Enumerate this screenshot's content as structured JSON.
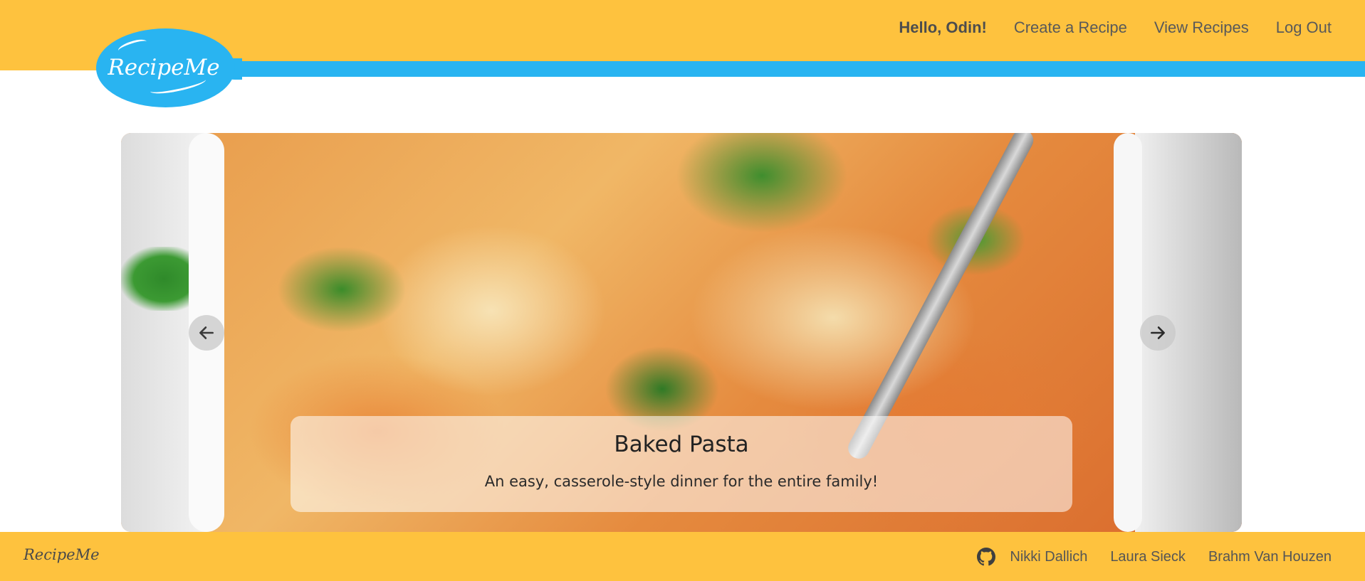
{
  "header": {
    "logo_text": "RecipeMe",
    "greeting": "Hello, Odin!",
    "nav": {
      "create": "Create a Recipe",
      "view": "View Recipes",
      "logout": "Log Out"
    },
    "colors": {
      "bar": "#fec23e",
      "spoon": "#29b4f1"
    }
  },
  "carousel": {
    "title": "Baked Pasta",
    "subtitle": "An easy, casserole-style dinner for the entire family!",
    "prev_icon": "arrow-left-icon",
    "next_icon": "arrow-right-icon"
  },
  "footer": {
    "logo_text": "RecipeMe",
    "icon": "github-icon",
    "authors": [
      "Nikki Dallich",
      "Laura Sieck",
      "Brahm Van Houzen"
    ]
  }
}
